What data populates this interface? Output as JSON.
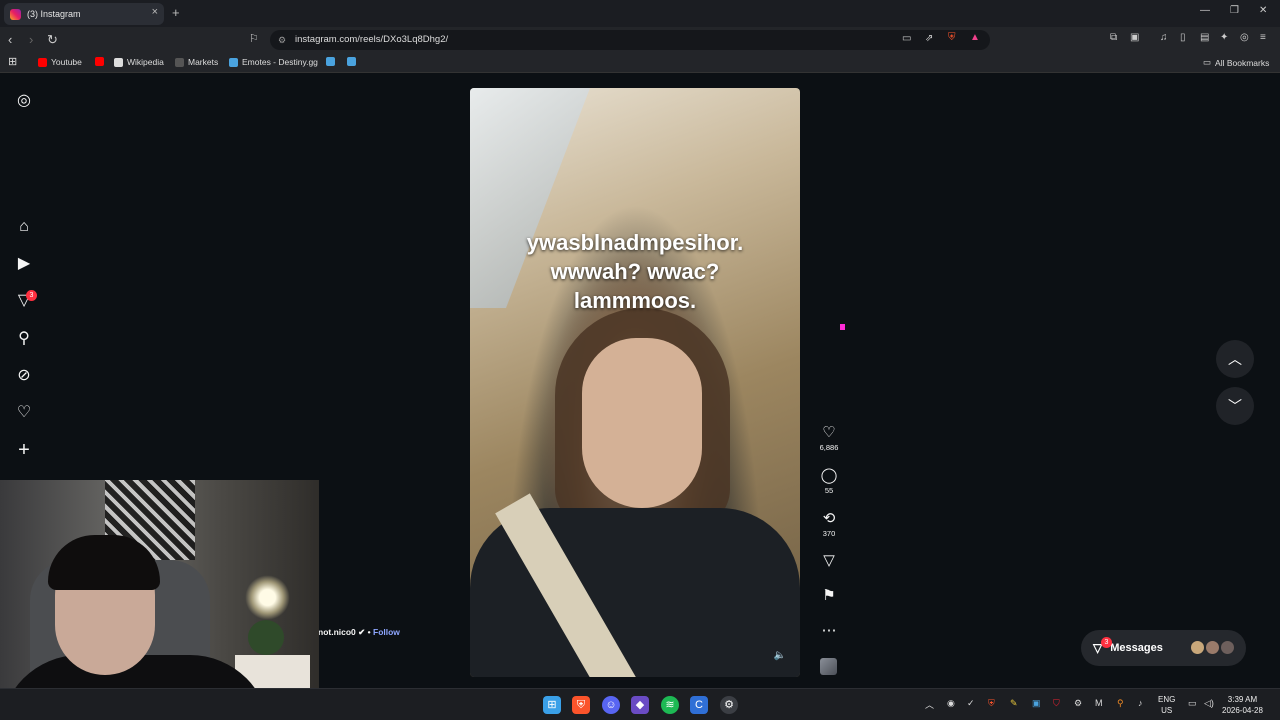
{
  "browser": {
    "tab_title": "(3) Instagram",
    "url": "instagram.com/reels/DXo3Lq8Dhg2/",
    "bookmarks": [
      "Youtube",
      "Wikipedia",
      "Markets",
      "Emotes - Destiny.gg"
    ],
    "all_bookmarks": "All Bookmarks"
  },
  "sidebar": {
    "notification_count": "3",
    "items": [
      "instagram-logo",
      "home",
      "reels",
      "messages",
      "search",
      "explore",
      "notifications",
      "create"
    ]
  },
  "reel": {
    "caption_lines": [
      "ywasblnadmpesihor.",
      "wwwah? wwac?",
      "lammmoos."
    ],
    "author": "not.nico0",
    "follow_label": "Follow",
    "separator": "•",
    "likes": "6,886",
    "comments": "55",
    "reposts": "370"
  },
  "messages": {
    "label": "Messages",
    "badge": "3"
  },
  "taskbar": {
    "lang_top": "ENG",
    "lang_bottom": "US",
    "time": "3:39 AM",
    "date": "2026-04-28"
  },
  "colors": {
    "background": "#0c1014",
    "badge": "#ff3040",
    "follow": "#8ea6ff"
  }
}
